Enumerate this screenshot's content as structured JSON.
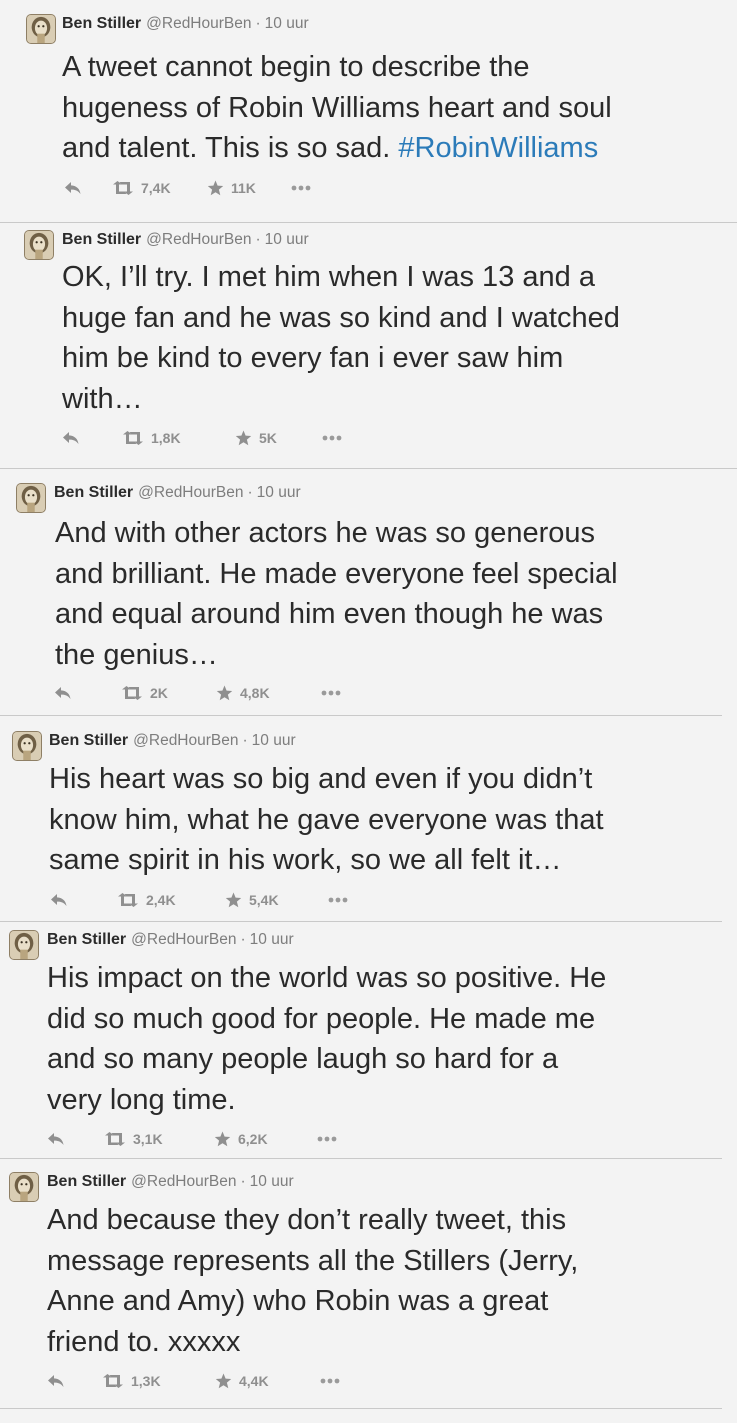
{
  "tweets": [
    {
      "author": {
        "name": "Ben Stiller",
        "handle": "@RedHourBen",
        "separator": "·",
        "time": "10 uur"
      },
      "lines": [
        "A tweet cannot begin to describe the",
        "hugeness of Robin Williams heart and soul"
      ],
      "last_line_text": "and talent. This is so sad. ",
      "hashtag": "#RobinWilliams",
      "retweets": "7,4K",
      "favorites": "11K"
    },
    {
      "author": {
        "name": "Ben Stiller",
        "handle": "@RedHourBen",
        "separator": "·",
        "time": "10 uur"
      },
      "lines": [
        "OK, I’ll try. I met him when I was 13 and a",
        "huge fan and he was so kind  and I watched",
        "him be kind to every fan i ever saw him",
        "with…"
      ],
      "retweets": "1,8K",
      "favorites": "5K"
    },
    {
      "author": {
        "name": "Ben Stiller",
        "handle": "@RedHourBen",
        "separator": "·",
        "time": "10 uur"
      },
      "lines": [
        "And with other actors he was so generous",
        "and brilliant. He made everyone feel special",
        "and equal around him even though he was",
        "the genius…"
      ],
      "retweets": "2K",
      "favorites": "4,8K"
    },
    {
      "author": {
        "name": "Ben Stiller",
        "handle": "@RedHourBen",
        "separator": "·",
        "time": "10 uur"
      },
      "lines": [
        "His heart was so big and even if you didn’t",
        "know him, what he gave everyone was that",
        "same spirit in his work, so we all felt it…"
      ],
      "retweets": "2,4K",
      "favorites": "5,4K"
    },
    {
      "author": {
        "name": "Ben Stiller",
        "handle": "@RedHourBen",
        "separator": "·",
        "time": "10 uur"
      },
      "lines": [
        "His impact on the world was so positive. He",
        "did so much good for people. He made me",
        "and so many people laugh so hard for a",
        "very long time."
      ],
      "retweets": "3,1K",
      "favorites": "6,2K"
    },
    {
      "author": {
        "name": "Ben Stiller",
        "handle": "@RedHourBen",
        "separator": "·",
        "time": "10 uur"
      },
      "lines": [
        "And because they don’t really tweet, this",
        "message represents all the Stillers  (Jerry,",
        "Anne and Amy) who Robin was a great",
        "friend to. xxxxx"
      ],
      "retweets": "1,3K",
      "favorites": "4,4K"
    }
  ],
  "icons": {
    "reply": "reply-icon",
    "retweet": "retweet-icon",
    "favorite": "star-icon",
    "more": "more-icon"
  },
  "colors": {
    "background": "#f3f3f3",
    "hashtag": "#2b7bb9",
    "meta": "#7d7d7d",
    "action": "#8f8f8f"
  }
}
